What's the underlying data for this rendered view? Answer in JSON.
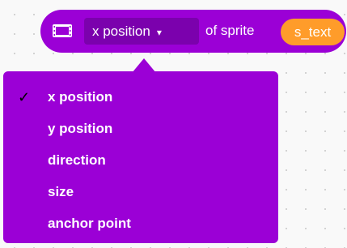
{
  "block": {
    "property_value": "x position",
    "dropdown_arrow": "▾",
    "of_sprite_label": "of sprite",
    "sprite_name": "s_text"
  },
  "dropdown": {
    "selected_check": "✓",
    "items": [
      {
        "label": "x position",
        "selected": true
      },
      {
        "label": "y position",
        "selected": false
      },
      {
        "label": "direction",
        "selected": false
      },
      {
        "label": "size",
        "selected": false
      },
      {
        "label": "anchor point",
        "selected": false
      }
    ]
  },
  "colors": {
    "block_purple": "#9b00d6",
    "field_purple": "#7b01ad",
    "sprite_orange": "#ff9c2a",
    "canvas_bg": "#f9f9f9"
  }
}
